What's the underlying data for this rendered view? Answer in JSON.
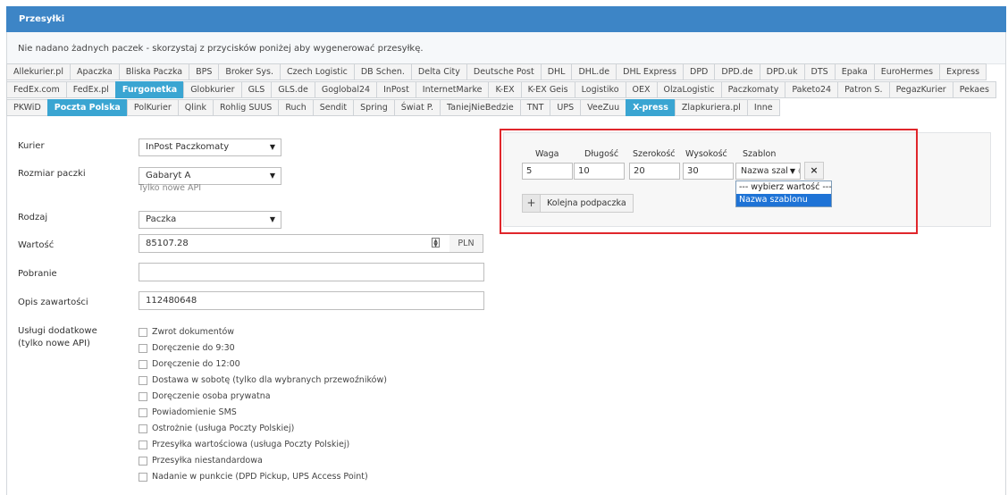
{
  "panel": {
    "title": "Przesyłki",
    "notice": "Nie nadano żadnych paczek - skorzystaj z przycisków poniżej aby wygenerować przesyłkę."
  },
  "carrier_tabs": {
    "row1": [
      "Allekurier.pl",
      "Apaczka",
      "Bliska Paczka",
      "BPS",
      "Broker Sys.",
      "Czech Logistic",
      "DB Schen.",
      "Delta City",
      "Deutsche Post",
      "DHL",
      "DHL.de",
      "DHL Express",
      "DPD",
      "DPD.de",
      "DPD.uk",
      "DTS",
      "Epaka",
      "EuroHermes",
      "Express"
    ],
    "row2": [
      "FedEx.com",
      "FedEx.pl",
      "Furgonetka",
      "Globkurier",
      "GLS",
      "GLS.de",
      "Goglobal24",
      "InPost",
      "InternetMarke",
      "K-EX",
      "K-EX Geis",
      "Logistiko",
      "OEX",
      "OlzaLogistic",
      "Paczkomaty",
      "Paketo24",
      "Patron S.",
      "PegazKurier",
      "Pekaes"
    ],
    "row3": [
      "PKWiD",
      "Poczta Polska",
      "PolKurier",
      "Qlink",
      "Rohlig SUUS",
      "Ruch",
      "Sendit",
      "Spring",
      "Świat P.",
      "TaniejNieBedzie",
      "TNT",
      "UPS",
      "VeeZuu",
      "X-press",
      "Zlapkuriera.pl",
      "Inne"
    ],
    "active": [
      "Furgonetka",
      "Poczta Polska",
      "X-press"
    ]
  },
  "form": {
    "kurier_label": "Kurier",
    "kurier_value": "InPost Paczkomaty",
    "rozmiar_label": "Rozmiar paczki",
    "rozmiar_value": "Gabaryt A",
    "rozmiar_hint": "Tylko nowe API",
    "rodzaj_label": "Rodzaj",
    "rodzaj_value": "Paczka",
    "wartosc_label": "Wartość",
    "wartosc_value": "85107.28",
    "currency": "PLN",
    "pobranie_label": "Pobranie",
    "pobranie_value": "",
    "opis_label": "Opis zawartości",
    "opis_value": "112480648",
    "uslugi_label_1": "Usługi dodatkowe",
    "uslugi_label_2": "(tylko nowe API)",
    "uslugi": [
      "Zwrot dokumentów",
      "Doręczenie do 9:30",
      "Doręczenie do 12:00",
      "Dostawa w sobotę (tylko dla wybranych przewoźników)",
      "Doręczenie osoba prywatna",
      "Powiadomienie SMS",
      "Ostrożnie (usługa Poczty Polskiej)",
      "Przesyłka wartościowa (usługa Poczty Polskiej)",
      "Przesyłka niestandardowa",
      "Nadanie w punkcie (DPD Pickup, UPS Access Point)"
    ]
  },
  "package": {
    "waga_label": "Waga",
    "dlugosc_label": "Długość",
    "szerokosc_label": "Szerokość",
    "wysokosc_label": "Wysokość",
    "szablon_label": "Szablon",
    "waga": "5",
    "dlugosc": "10",
    "szerokosc": "20",
    "wysokosc": "30",
    "szablon_value": "Nazwa szablonu",
    "szablon_options": [
      "--- wybierz wartość ---",
      "Nazwa szablonu"
    ],
    "remove_icon": "×",
    "add_label": "Kolejna podpaczka",
    "add_icon": "+"
  }
}
